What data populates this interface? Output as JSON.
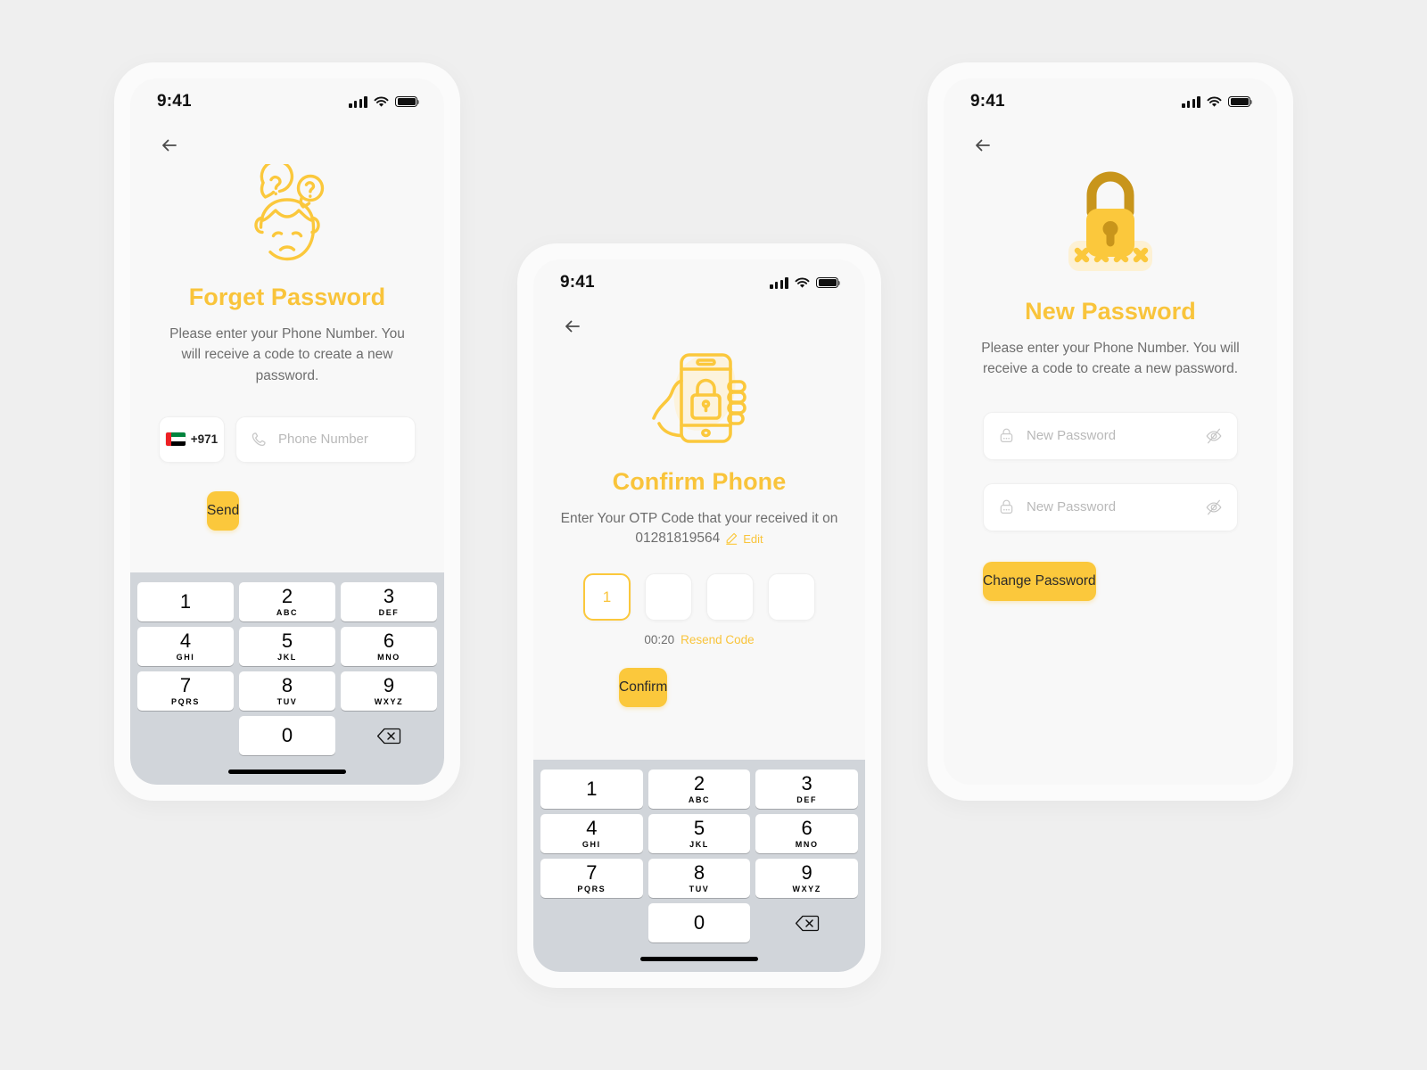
{
  "theme": {
    "accent": "#FBC83C",
    "accent_text": "#F9C43B",
    "page_bg": "#EFEFEF",
    "screen_bg": "#F8F8F8",
    "keypad_bg": "#D1D5DA",
    "body_text": "#6E6E6E"
  },
  "status_bar": {
    "time": "9:41",
    "signal_icon": "signal-bars-icon",
    "wifi_icon": "wifi-icon",
    "battery_icon": "battery-full-icon"
  },
  "keypad": {
    "keys": [
      {
        "num": "1",
        "abc": ""
      },
      {
        "num": "2",
        "abc": "ABC"
      },
      {
        "num": "3",
        "abc": "DEF"
      },
      {
        "num": "4",
        "abc": "GHI"
      },
      {
        "num": "5",
        "abc": "JKL"
      },
      {
        "num": "6",
        "abc": "MNO"
      },
      {
        "num": "7",
        "abc": "PQRS"
      },
      {
        "num": "8",
        "abc": "TUV"
      },
      {
        "num": "9",
        "abc": "WXYZ"
      },
      {
        "num": "0",
        "abc": ""
      }
    ],
    "backspace_icon": "backspace-delete-icon"
  },
  "screen_1": {
    "back_icon": "back-arrow-icon",
    "illustration_icon": "confused-face-question-marks-icon",
    "title": "Forget Password",
    "subtitle": "Please enter your Phone Number. You will receive a code to create a new password.",
    "country_code": "+971",
    "flag_icon": "uae-flag-icon",
    "phone_icon": "phone-handset-icon",
    "phone_placeholder": "Phone Number",
    "phone_value": "",
    "send_label": "Send"
  },
  "screen_2": {
    "back_icon": "back-arrow-icon",
    "illustration_icon": "hand-holding-phone-lock-icon",
    "title": "Confirm Phone",
    "subtitle": "Enter Your OTP Code that your received it on",
    "phone_number": "01281819564",
    "edit_icon": "pencil-edit-icon",
    "edit_label": "Edit",
    "otp_digits": [
      "1",
      "",
      "",
      ""
    ],
    "timer": "00:20",
    "resend_label": "Resend Code",
    "confirm_label": "Confirm"
  },
  "screen_3": {
    "back_icon": "back-arrow-icon",
    "illustration_icon": "padlock-xxxx-icon",
    "illustration_mask": "XXXX",
    "title": "New Password",
    "subtitle": "Please enter your Phone Number. You will receive a code to create a new password.",
    "fields": [
      {
        "lock_icon": "password-lock-icon",
        "placeholder": "New Password",
        "value": "",
        "eye_icon": "eye-hidden-icon"
      },
      {
        "lock_icon": "password-lock-icon",
        "placeholder": "New Password",
        "value": "",
        "eye_icon": "eye-hidden-icon"
      }
    ],
    "change_label": "Change Password"
  }
}
